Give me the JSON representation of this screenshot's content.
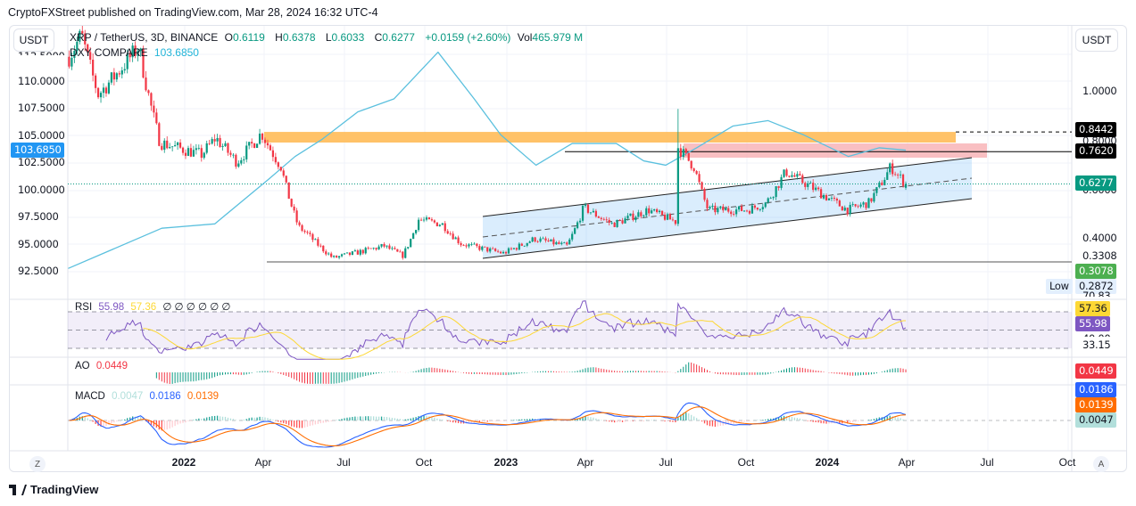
{
  "header": {
    "published": "CryptoFXStreet published on TradingView.com, Mar 28, 2024 16:32 UTC-4"
  },
  "currency_left": "USDT",
  "currency_right": "USDT",
  "legend": {
    "symbol": "XRP / TetherUS, 3D, BINANCE",
    "o_label": "O",
    "o": "0.6119",
    "h_label": "H",
    "h": "0.6378",
    "l_label": "L",
    "l": "0.6033",
    "c_label": "C",
    "c": "0.6277",
    "change": "+0.0159 (+2.60%)",
    "vol_label": "Vol",
    "vol": "465.979 M",
    "compare_label": "DXY COMPARE",
    "compare_value": "103.6850"
  },
  "left_axis": [
    "112.5000",
    "110.0000",
    "107.5000",
    "105.0000",
    "102.5000",
    "100.0000",
    "97.5000",
    "95.0000",
    "92.5000"
  ],
  "left_tag": "103.6850",
  "right_axis": {
    "p1": "1.0000",
    "p2": "0.8000",
    "p3": "0.6000",
    "p4": "0.4000",
    "p5": "0.3308"
  },
  "right_tags": {
    "t1": "0.8442",
    "t2": "0.7620",
    "t3": "0.6277",
    "t4": "0.3078",
    "low_label": "Low",
    "low": "0.2872"
  },
  "rsi": {
    "label": "RSI",
    "value": "55.98",
    "ma": "57.36",
    "extra": "∅ ∅ ∅ ∅ ∅ ∅",
    "upper": "70.83",
    "lower_mid": "40.00",
    "lower": "33.15"
  },
  "ao": {
    "label": "AO",
    "value": "0.0449"
  },
  "macd": {
    "label": "MACD",
    "hist": "0.0047",
    "macd": "0.0186",
    "signal": "0.0139"
  },
  "time_axis": [
    "2022",
    "Apr",
    "Jul",
    "Oct",
    "2023",
    "Apr",
    "Jul",
    "Oct",
    "2024",
    "Apr",
    "Jul",
    "Oct"
  ],
  "buttons": {
    "z": "Z",
    "a": "A"
  },
  "brand": "TradingView",
  "colors": {
    "up": "#089981",
    "down": "#f23645",
    "dxy": "#5bc0de",
    "rsi": "#7e57c2",
    "rsi_ma": "#fdd835",
    "macd": "#2962ff",
    "signal": "#ff6d00"
  },
  "chart_data": {
    "type": "candlestick",
    "title": "XRP / TetherUS, 3D, BINANCE",
    "price_path": [
      [
        "2021-08-22",
        1.15
      ],
      [
        "2021-09-06",
        1.25
      ],
      [
        "2021-09-25",
        1.0
      ],
      [
        "2021-11-10",
        1.2
      ],
      [
        "2021-12-04",
        0.8
      ],
      [
        "2022-01-20",
        0.75
      ],
      [
        "2022-02-05",
        0.82
      ],
      [
        "2022-03-01",
        0.72
      ],
      [
        "2022-03-29",
        0.84
      ],
      [
        "2022-04-20",
        0.7
      ],
      [
        "2022-05-10",
        0.45
      ],
      [
        "2022-05-20",
        0.42
      ],
      [
        "2022-06-18",
        0.32
      ],
      [
        "2022-08-15",
        0.37
      ],
      [
        "2022-09-05",
        0.33
      ],
      [
        "2022-09-23",
        0.48
      ],
      [
        "2022-10-20",
        0.46
      ],
      [
        "2022-11-10",
        0.38
      ],
      [
        "2022-12-28",
        0.34
      ],
      [
        "2023-02-01",
        0.4
      ],
      [
        "2023-03-10",
        0.37
      ],
      [
        "2023-03-29",
        0.53
      ],
      [
        "2023-05-01",
        0.46
      ],
      [
        "2023-06-10",
        0.52
      ],
      [
        "2023-07-12",
        0.47
      ],
      [
        "2023-07-14",
        0.78
      ],
      [
        "2023-08-01",
        0.7
      ],
      [
        "2023-08-17",
        0.52
      ],
      [
        "2023-10-01",
        0.52
      ],
      [
        "2023-10-22",
        0.55
      ],
      [
        "2023-11-13",
        0.68
      ],
      [
        "2023-12-10",
        0.62
      ],
      [
        "2024-01-22",
        0.52
      ],
      [
        "2024-02-15",
        0.55
      ],
      [
        "2024-03-11",
        0.7
      ],
      [
        "2024-03-28",
        0.6277
      ]
    ],
    "last_candle": {
      "open": 0.6119,
      "high": 0.6378,
      "low": 0.6033,
      "close": 0.6277
    },
    "dxy_compare": [
      [
        "2021-08-22",
        92.8
      ],
      [
        "2021-12-06",
        96.5
      ],
      [
        "2022-02-04",
        96.9
      ],
      [
        "2022-04-06",
        101.0
      ],
      [
        "2022-05-06",
        103.1
      ],
      [
        "2022-06-06",
        104.7
      ],
      [
        "2022-07-16",
        107.2
      ],
      [
        "2022-08-26",
        108.4
      ],
      [
        "2022-10-15",
        112.7
      ],
      [
        "2022-11-25",
        108.4
      ],
      [
        "2022-12-25",
        105.1
      ],
      [
        "2023-02-03",
        102.3
      ],
      [
        "2023-03-16",
        104.3
      ],
      [
        "2023-05-05",
        104.3
      ],
      [
        "2023-06-05",
        102.7
      ],
      [
        "2023-06-30",
        102.3
      ],
      [
        "2023-08-04",
        103.9
      ],
      [
        "2023-09-14",
        105.9
      ],
      [
        "2023-10-24",
        106.4
      ],
      [
        "2023-12-03",
        105.1
      ],
      [
        "2024-01-23",
        103.1
      ],
      [
        "2024-02-27",
        103.9
      ],
      [
        "2024-03-28",
        103.685
      ]
    ],
    "levels": {
      "supply_zone": [
        0.8,
        0.8442
      ],
      "resistance_zone": [
        0.762,
        0.82
      ],
      "resistance_line": 0.762,
      "support_line": 0.3078,
      "low": 0.2872
    },
    "channel": {
      "start": "2022-11-20",
      "end": "2024-06-10",
      "lower": [
        0.33,
        0.58
      ],
      "upper": [
        0.5,
        0.75
      ]
    },
    "right_ylim": [
      0.27,
      1.3
    ],
    "left_ylim": [
      92,
      114
    ],
    "rsi_levels": [
      70,
      50,
      30
    ]
  }
}
